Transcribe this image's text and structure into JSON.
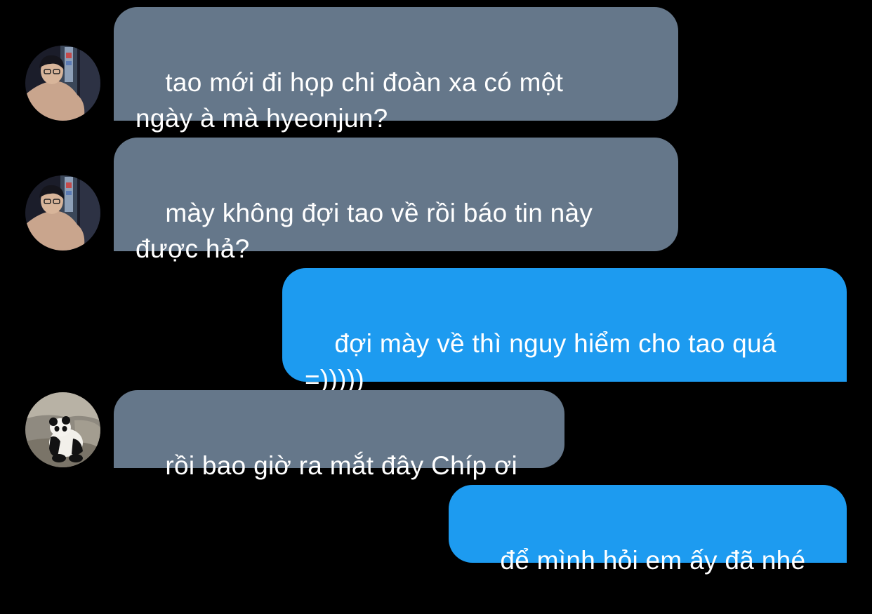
{
  "conversation": {
    "messages": [
      {
        "direction": "incoming",
        "sender_avatar": "person-avatar",
        "text": "tao mới đi họp chi đoàn xa có một\nngày à mà hyeonjun?"
      },
      {
        "direction": "incoming",
        "sender_avatar": "person-avatar",
        "text": "mày không đợi tao về rồi báo tin này\nđược hả?"
      },
      {
        "direction": "outgoing",
        "text": "đợi mày về thì nguy hiểm cho tao quá\n=)))))"
      },
      {
        "direction": "incoming",
        "sender_avatar": "panda-avatar",
        "text": "rồi bao giờ ra mắt đây Chíp ơi"
      },
      {
        "direction": "outgoing",
        "text": "để mình hỏi em ấy đã nhé"
      }
    ]
  },
  "colors": {
    "background": "#000000",
    "incoming_bubble": "#65778a",
    "outgoing_bubble": "#1d9bf0",
    "text": "#ffffff"
  }
}
